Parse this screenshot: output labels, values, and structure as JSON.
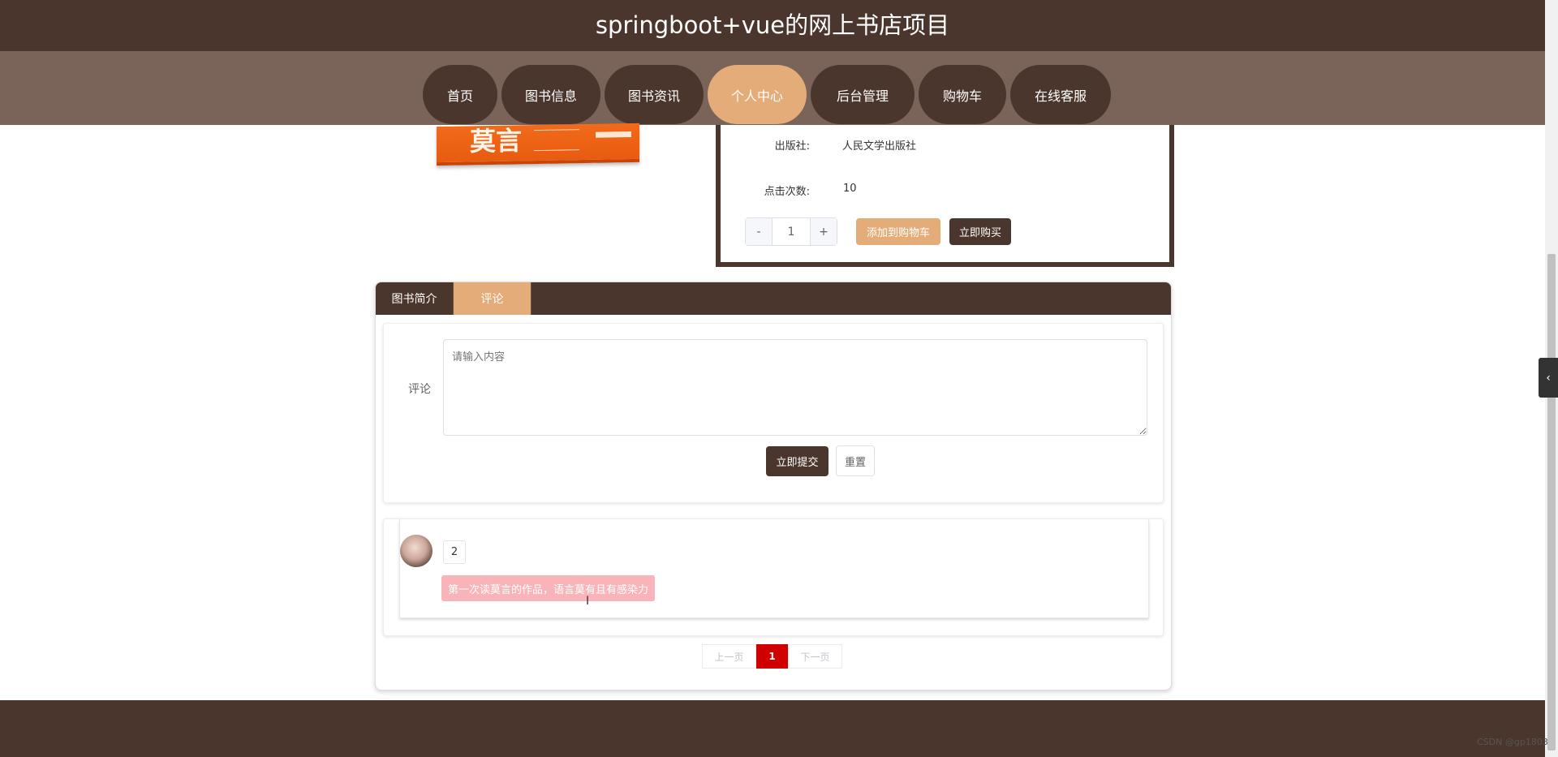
{
  "header": {
    "title": "springboot+vue的网上书店项目"
  },
  "nav": {
    "items": [
      {
        "label": "首页"
      },
      {
        "label": "图书信息"
      },
      {
        "label": "图书资讯"
      },
      {
        "label": "个人中心",
        "active": true
      },
      {
        "label": "后台管理"
      },
      {
        "label": "购物车"
      },
      {
        "label": "在线客服"
      }
    ]
  },
  "book": {
    "cover_title": "莫言",
    "publisher_label": "出版社:",
    "publisher_value": "人民文学出版社",
    "clicks_label": "点击次数:",
    "clicks_value": "10",
    "quantity": "1",
    "minus": "-",
    "plus": "+",
    "add_to_cart": "添加到购物车",
    "buy_now": "立即购买"
  },
  "tabs": {
    "intro": "图书简介",
    "comments": "评论"
  },
  "comment_form": {
    "label": "评论",
    "placeholder": "请输入内容",
    "submit": "立即提交",
    "reset": "重置"
  },
  "comments": [
    {
      "user": "2",
      "text": "第一次读莫言的作品，语言莫有且有感染力"
    }
  ],
  "pagination": {
    "prev": "上一页",
    "current": "1",
    "next": "下一页"
  },
  "side_tab": {
    "icon": "chevron-left-icon",
    "glyph": "‹"
  },
  "watermark": "CSDN @gp1803",
  "colors": {
    "primary": "#4b362d",
    "accent": "#e4ac78",
    "nav_bar": "#7a6459",
    "page_active": "#d00000",
    "comment_bg": "#f8b4b8"
  }
}
